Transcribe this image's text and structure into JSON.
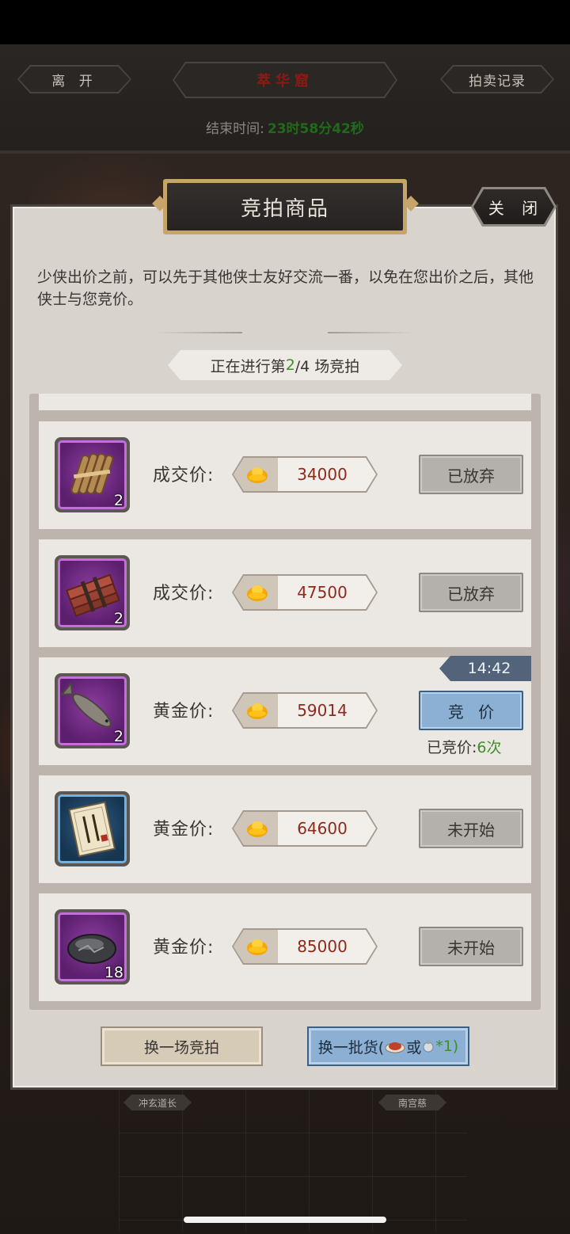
{
  "header": {
    "leave_label": "离 开",
    "title": "萃华窟",
    "records_label": "拍卖记录",
    "end_time_label": "结束时间:",
    "end_time_value": "23时58分42秒"
  },
  "npc_tags": [
    "冲玄道长",
    "南宫慈"
  ],
  "dialog": {
    "title": "竞拍商品",
    "close_label": "关 闭",
    "intro": "少侠出价之前，可以先于其他侠士友好交流一番，以免在您出价之后，其他侠士与您竞价。",
    "round": {
      "prefix": "正在进行第 ",
      "current": "2",
      "suffix": "/4 场竞拍"
    }
  },
  "items": [
    {
      "icon": "bundled-sticks-icon",
      "rarity": "purple",
      "count": "2",
      "price_label": "成交价:",
      "price": "34000",
      "action": "已放弃",
      "action_state": "disabled"
    },
    {
      "icon": "brick-bundle-icon",
      "rarity": "purple",
      "count": "2",
      "price_label": "成交价:",
      "price": "47500",
      "action": "已放弃",
      "action_state": "disabled"
    },
    {
      "icon": "dried-fish-icon",
      "rarity": "purple",
      "count": "2",
      "price_label": "黄金价:",
      "price": "59014",
      "action": "竞 价",
      "action_state": "active",
      "timer": "14:42",
      "bid_count_label": "已竞价:",
      "bid_count": "6",
      "bid_count_unit": "次"
    },
    {
      "icon": "scroll-book-icon",
      "rarity": "blue",
      "count": "",
      "price_label": "黄金价:",
      "price": "64600",
      "action": "未开始",
      "action_state": "disabled"
    },
    {
      "icon": "black-stone-icon",
      "rarity": "purple",
      "count": "18",
      "price_label": "黄金价:",
      "price": "85000",
      "action": "未开始",
      "action_state": "disabled"
    }
  ],
  "footer": {
    "switch_auction_label": "换一场竞拍",
    "refresh_label_prefix": "换一批货(",
    "refresh_label_or": "或",
    "refresh_label_suffix": "*1)"
  },
  "colors": {
    "accent_green": "#3f8f2a",
    "price_red": "#8e2a1c",
    "purple_rarity": "#c26fd6",
    "blue_rarity": "#6fb2e6",
    "bid_button_blue": "#8bb0d4"
  }
}
